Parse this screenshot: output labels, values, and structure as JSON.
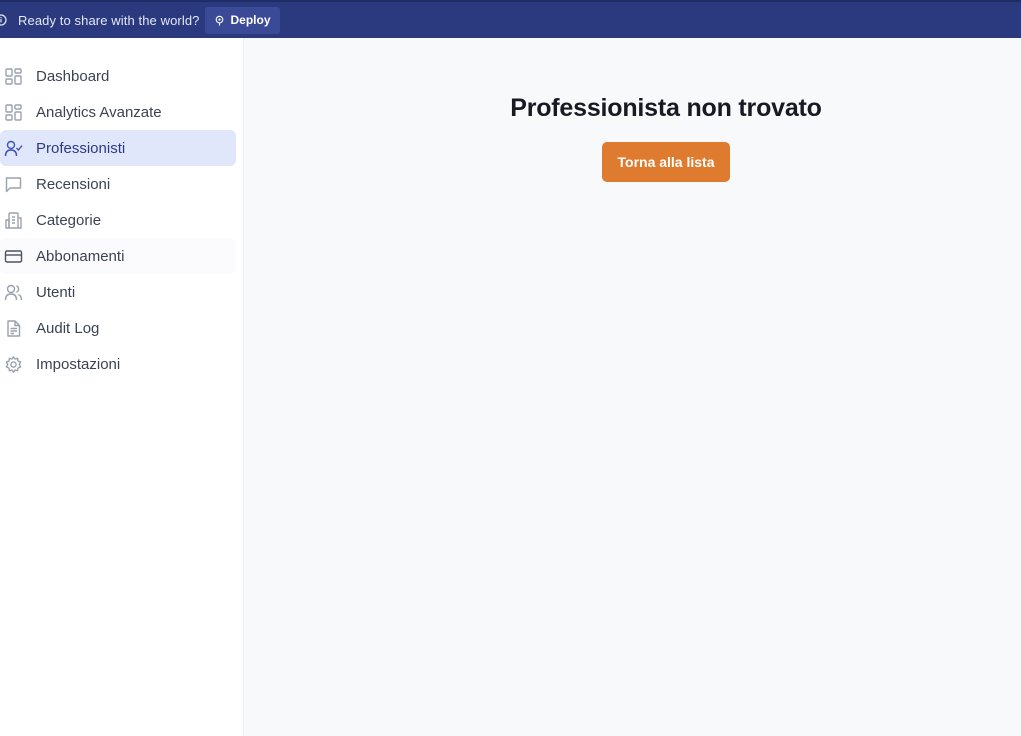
{
  "topbar": {
    "message": "Ready to share with the world?",
    "deploy_label": "Deploy",
    "info_icon": "info-icon",
    "deploy_icon": "rocket-icon",
    "background": "#2b3a7e"
  },
  "sidebar": {
    "items": [
      {
        "label": "Dashboard",
        "icon": "dashboard-icon",
        "active": false
      },
      {
        "label": "Analytics Avanzate",
        "icon": "analytics-icon",
        "active": false
      },
      {
        "label": "Professionisti",
        "icon": "user-check-icon",
        "active": true
      },
      {
        "label": "Recensioni",
        "icon": "message-square-icon",
        "active": false
      },
      {
        "label": "Categorie",
        "icon": "building-icon",
        "active": false
      },
      {
        "label": "Abbonamenti",
        "icon": "credit-card-icon",
        "active": false
      },
      {
        "label": "Utenti",
        "icon": "users-icon",
        "active": false
      },
      {
        "label": "Audit Log",
        "icon": "file-text-icon",
        "active": false
      },
      {
        "label": "Impostazioni",
        "icon": "settings-icon",
        "active": false
      }
    ]
  },
  "main": {
    "title": "Professionista non trovato",
    "back_button_label": "Torna alla lista",
    "accent": "#de7b2f"
  }
}
